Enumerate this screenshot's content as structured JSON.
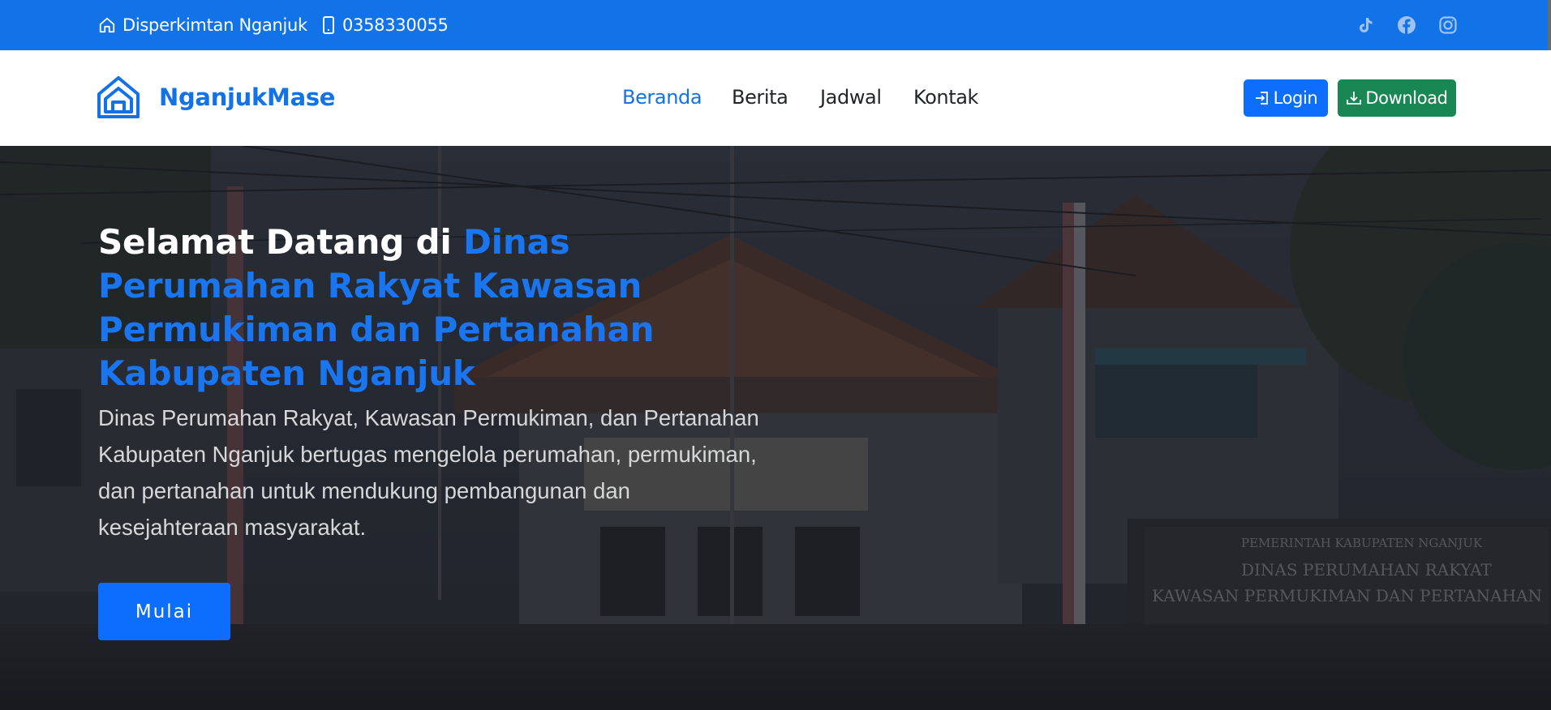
{
  "topbar": {
    "office_name": "Disperkimtan Nganjuk",
    "phone": "0358330055",
    "social_icons": [
      "tiktok-icon",
      "facebook-icon",
      "instagram-icon"
    ]
  },
  "navbar": {
    "brand": "NganjukMase",
    "links": [
      {
        "label": "Beranda",
        "active": true
      },
      {
        "label": "Berita",
        "active": false
      },
      {
        "label": "Jadwal",
        "active": false
      },
      {
        "label": "Kontak",
        "active": false
      }
    ],
    "login_label": "Login",
    "download_label": "Download"
  },
  "hero": {
    "title_prefix": "Selamat Datang di ",
    "title_highlight": "Dinas Perumahan Rakyat Kawasan Permukiman dan Pertanahan Kabupaten Nganjuk",
    "description": "Dinas Perumahan Rakyat, Kawasan Permukiman, dan Pertanahan Kabupaten Nganjuk bertugas mengelola perumahan, permukiman, dan pertanahan untuk mendukung pembangunan dan kesejahteraan masyarakat.",
    "cta_label": "Mulai",
    "signboard_lines": [
      "PEMERINTAH KABUPATEN NGANJUK",
      "DINAS PERUMAHAN RAKYAT",
      "KAWASAN PERMUKIMAN DAN PERTANAHAN"
    ]
  },
  "colors": {
    "primary": "#1272e8",
    "login_button": "#0d6efd",
    "download_button": "#198754",
    "hero_overlay": "#1c2027"
  }
}
